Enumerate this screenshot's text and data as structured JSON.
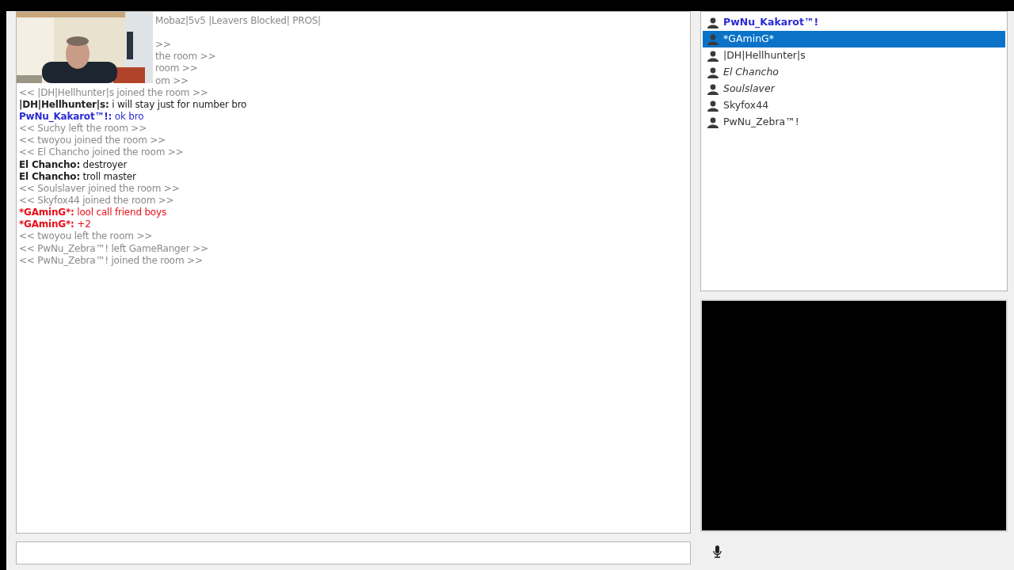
{
  "chat": {
    "lines": [
      {
        "kind": "partial",
        "text": "Mobaz|5v5 |Leavers Blocked| PROS|"
      },
      {
        "kind": "partial",
        "text": ">>"
      },
      {
        "kind": "partial",
        "text": "the room >>"
      },
      {
        "kind": "partial",
        "text": "room >>"
      },
      {
        "kind": "partial",
        "text": "om >>"
      },
      {
        "kind": "system",
        "text": "<< |DH|Hellhunter|s joined the room >>"
      },
      {
        "kind": "message",
        "name": "|DH|Hellhunter|s:",
        "text": "i will stay just for number bro",
        "color": "#222222"
      },
      {
        "kind": "message",
        "name": "PwNu_Kakarot™!:",
        "text": "ok bro",
        "color": "#2b2bd4"
      },
      {
        "kind": "system",
        "text": "<< Suchy left the room >>"
      },
      {
        "kind": "system",
        "text": "<< twoyou joined the room >>"
      },
      {
        "kind": "system",
        "text": "<< El Chancho joined the room >>"
      },
      {
        "kind": "message",
        "name": "El Chancho:",
        "text": "destroyer",
        "color": "#222222"
      },
      {
        "kind": "message",
        "name": "El Chancho:",
        "text": "troll master",
        "color": "#222222"
      },
      {
        "kind": "system",
        "text": "<< Soulslaver joined the room >>"
      },
      {
        "kind": "system",
        "text": "<< Skyfox44 joined the room >>"
      },
      {
        "kind": "message",
        "name": "*GAminG*:",
        "text": "lool call friend boys",
        "color": "#e8101a"
      },
      {
        "kind": "message",
        "name": "*GAminG*:",
        "text": "+2",
        "color": "#e8101a"
      },
      {
        "kind": "system",
        "text": "<< twoyou left the room >>"
      },
      {
        "kind": "system",
        "text": "<< PwNu_Zebra™! left GameRanger >>"
      },
      {
        "kind": "system",
        "text": "<< PwNu_Zebra™! joined the room >>"
      }
    ]
  },
  "users": [
    {
      "name": "PwNu_Kakarot™!",
      "kind": "host",
      "selected": false
    },
    {
      "name": "*GAminG*",
      "kind": "normal",
      "selected": true
    },
    {
      "name": "|DH|Hellhunter|s",
      "kind": "normal",
      "selected": false
    },
    {
      "name": "El Chancho",
      "kind": "away",
      "selected": false
    },
    {
      "name": "Soulslaver",
      "kind": "away",
      "selected": false
    },
    {
      "name": "Skyfox44",
      "kind": "normal",
      "selected": false
    },
    {
      "name": "PwNu_Zebra™!",
      "kind": "normal",
      "selected": false
    }
  ]
}
